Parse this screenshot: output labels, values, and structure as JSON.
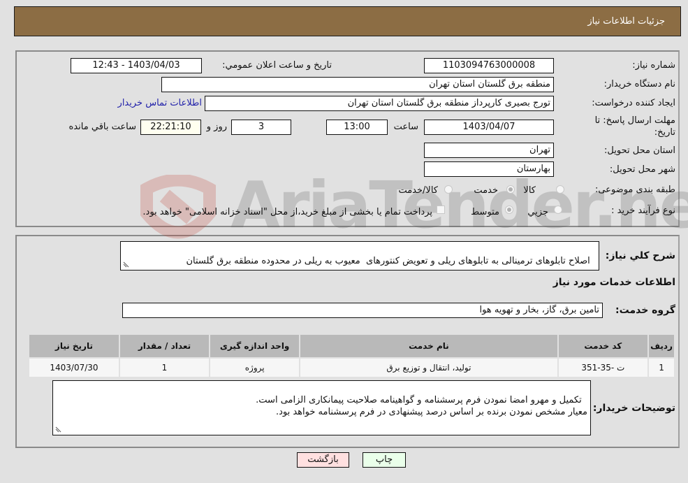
{
  "header": {
    "title": "جزئیات اطلاعات نیاز"
  },
  "form": {
    "need_number": {
      "label": "شماره نیاز:",
      "value": "1103094763000008"
    },
    "announce_datetime": {
      "label": "تاريخ و ساعت اعلان عمومي:",
      "value": "1403/04/03 - 12:43"
    },
    "buyer_org": {
      "label": "نام دستگاه خريدار:",
      "value": "منطقه برق گلستان استان تهران"
    },
    "requester": {
      "label": "ايجاد کننده درخواست:",
      "value": "تورج بصیری کارپرداز منطقه برق گلستان استان تهران"
    },
    "buyer_contact_link": "اطلاعات تماس خريدار",
    "deadline": {
      "label": "مهلت ارسال پاسخ: تا تاريخ:",
      "date": "1403/04/07",
      "time_label": "ساعت",
      "time": "13:00",
      "days": "3",
      "days_label": "روز و",
      "remaining": "22:21:10",
      "remaining_label": "ساعت باقي مانده"
    },
    "province": {
      "label": "استان محل تحويل:",
      "value": "تهران"
    },
    "city": {
      "label": "شهر محل تحويل:",
      "value": "بهارستان"
    },
    "category": {
      "label": "طبقه بندی موضوعی:",
      "options": [
        {
          "label": "کالا",
          "checked": false
        },
        {
          "label": "خدمت",
          "checked": true
        },
        {
          "label": "کالا/خدمت",
          "checked": false
        }
      ]
    },
    "purchase_type": {
      "label": "نوع فرآيند خريد :",
      "options": [
        {
          "label": "جزيي",
          "checked": false
        },
        {
          "label": "متوسط",
          "checked": true
        }
      ],
      "treasury_note": "پرداخت تمام يا بخشی از مبلغ خريد،از محل \"اسناد خزانه اسلامی\" خواهد بود.",
      "treasury_checked": false
    }
  },
  "description": {
    "label": "شرح کلي نياز:",
    "value": "اصلاح تابلوهای ترمینالی به تابلوهای ریلی و تعویض کنتورهای  معیوب به ریلی در محدوده منطقه برق گلستان"
  },
  "services_section_title": "اطلاعات خدمات مورد نياز",
  "service_group": {
    "label": "گروه خدمت:",
    "value": "تامین برق، گاز، بخار و تهویه هوا"
  },
  "table": {
    "headers": [
      "رديف",
      "کد خدمت",
      "نام خدمت",
      "واحد اندازه گيری",
      "تعداد / مقدار",
      "تاريخ نياز"
    ],
    "rows": [
      [
        "1",
        "ت -35-351",
        "تولید، انتقال و توزیع برق",
        "پروژه",
        "1",
        "1403/07/30"
      ]
    ]
  },
  "buyer_notes": {
    "label": "توضيحات خريدار:",
    "value": "تکمیل و مهرو امضا نمودن فرم پرسشنامه و گواهینامه صلاحیت پیمانکاری الزامی است.\nمعیار مشخص نمودن برنده بر اساس درصد پیشنهادی در فرم پرسشنامه خواهد بود."
  },
  "buttons": {
    "print": "چاپ",
    "back": "بازگشت"
  },
  "watermark": "AriaTender.neT",
  "colors": {
    "header_bg": "#8c6d44",
    "print_bg": "#eaffea",
    "back_bg": "#ffe0e0",
    "link": "#2222aa"
  }
}
